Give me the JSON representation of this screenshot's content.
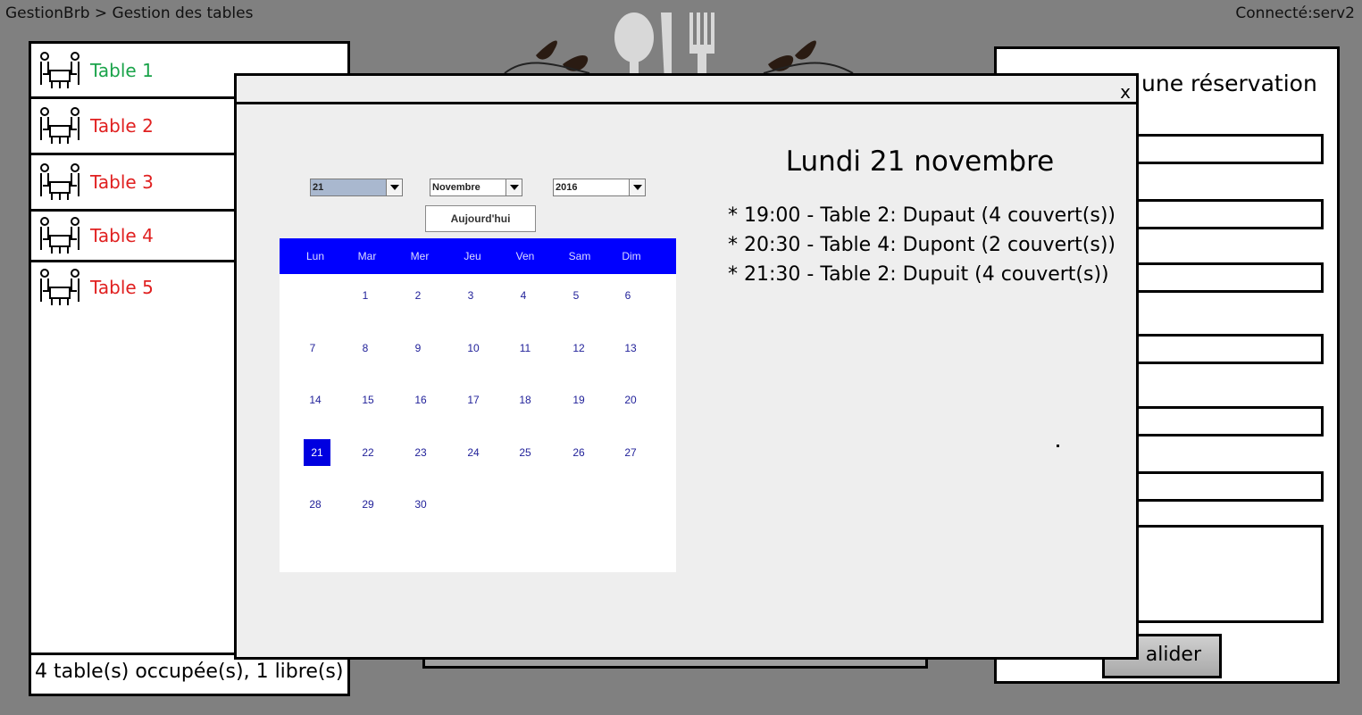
{
  "header": {
    "breadcrumb": "GestionBrb > Gestion des tables",
    "connected": "Connecté:serv2"
  },
  "tables": {
    "items": [
      {
        "label": "Table 1",
        "color": "#1aa34a",
        "icon": "dining-table-icon"
      },
      {
        "label": "Table 2",
        "color": "#e02020",
        "icon": "dining-table-icon"
      },
      {
        "label": "Table 3",
        "color": "#e02020",
        "icon": "dining-table-icon"
      },
      {
        "label": "Table 4",
        "color": "#e02020",
        "icon": "dining-table-icon"
      },
      {
        "label": "Table 5",
        "color": "#e02020",
        "icon": "dining-table-icon"
      }
    ],
    "footer": "4 table(s) occupée(s), 1 libre(s)"
  },
  "reservation_panel": {
    "title_visible": "une réservation",
    "submit_visible": "alider"
  },
  "modal": {
    "close_label": "x",
    "date_title": "Lundi 21 novembre",
    "reservations": [
      "* 19:00 - Table 2: Dupaut (4 couvert(s))",
      "* 20:30 - Table 4: Dupont (2 couvert(s))",
      "* 21:30 - Table 2: Dupuit (4 couvert(s))"
    ]
  },
  "calendar": {
    "day_value": "21",
    "month_value": "Novembre",
    "year_value": "2016",
    "today_label": "Aujourd'hui",
    "weekdays": [
      "Lun",
      "Mar",
      "Mer",
      "Jeu",
      "Ven",
      "Sam",
      "Dim"
    ],
    "days": [
      "1",
      "2",
      "3",
      "4",
      "5",
      "6",
      "7",
      "8",
      "9",
      "10",
      "11",
      "12",
      "13",
      "14",
      "15",
      "16",
      "17",
      "18",
      "19",
      "20",
      "21",
      "22",
      "23",
      "24",
      "25",
      "26",
      "27",
      "28",
      "29",
      "30"
    ],
    "selected_day": "21",
    "header_color": "#0000ff"
  }
}
